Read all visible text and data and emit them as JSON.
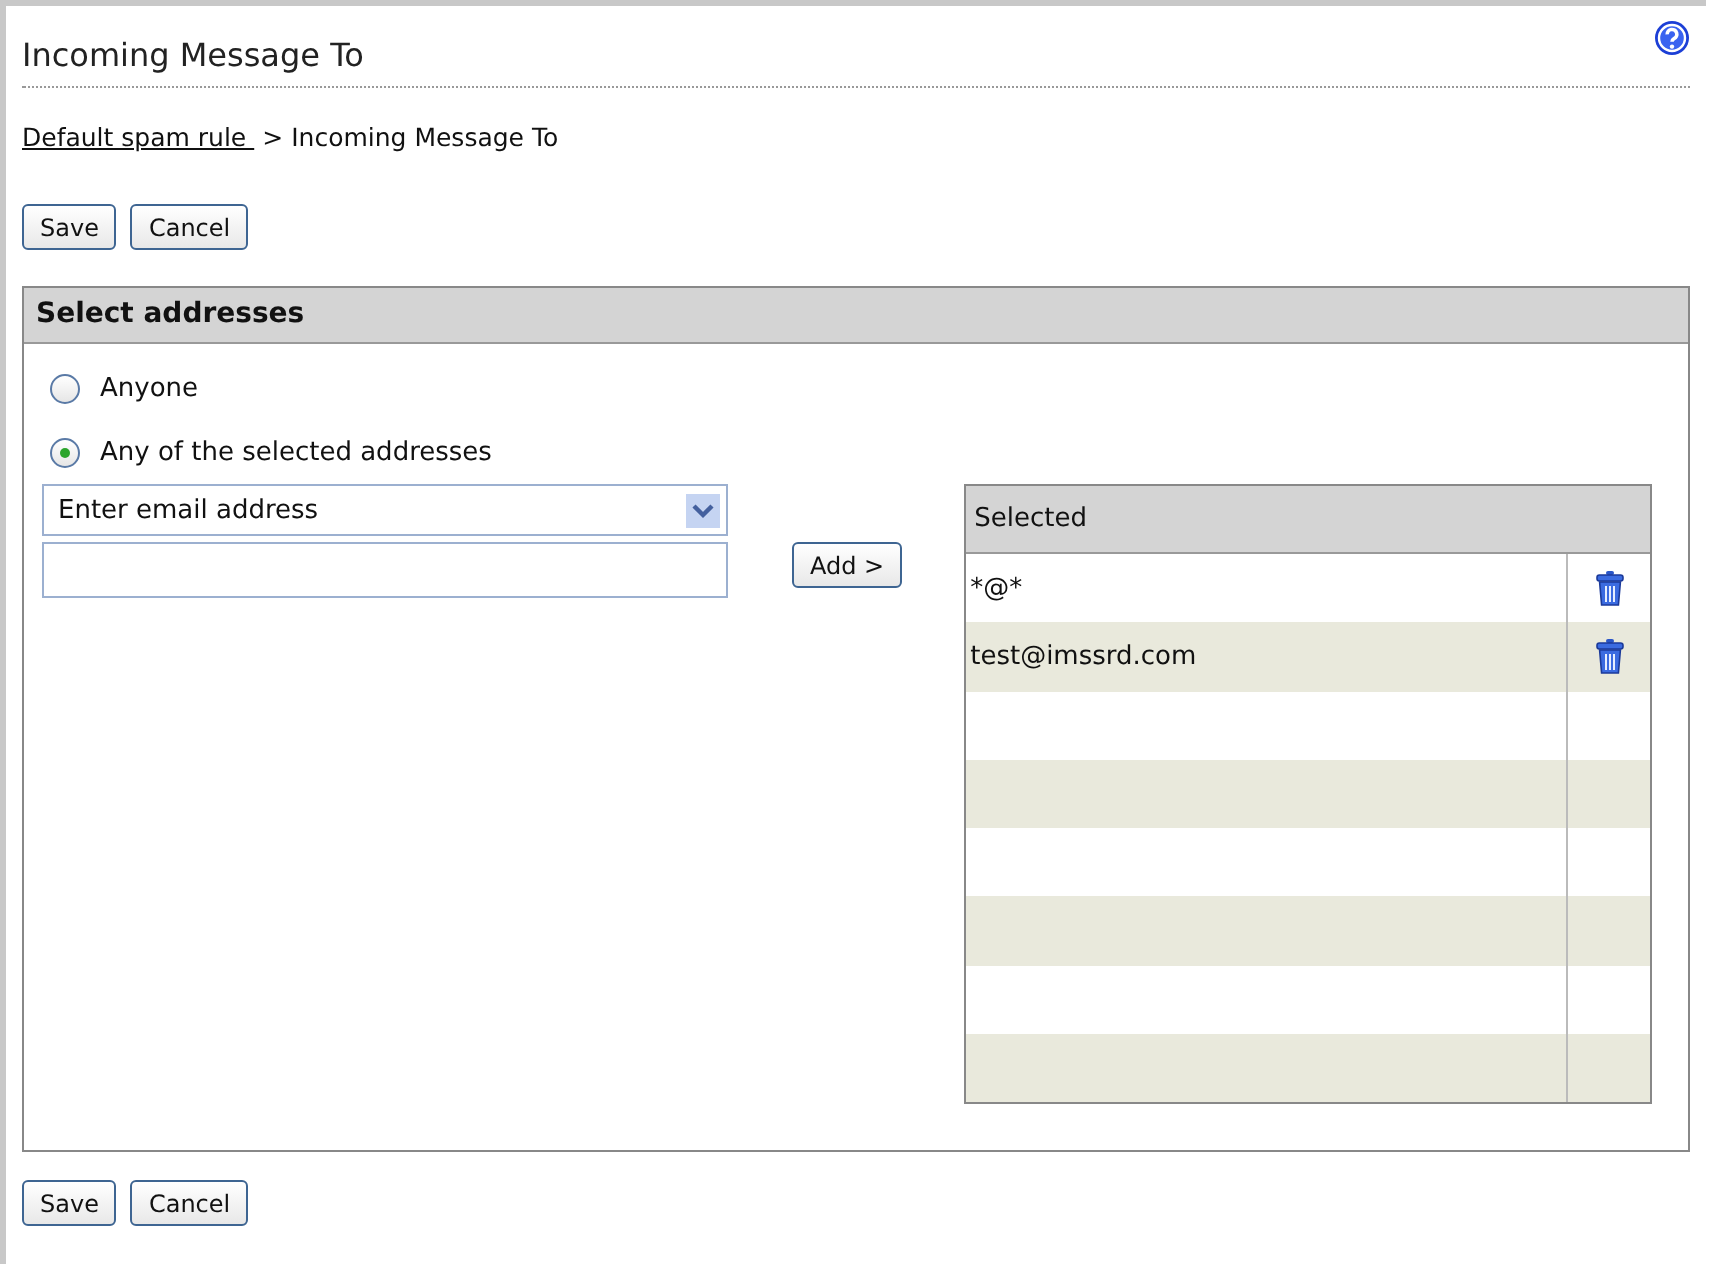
{
  "page": {
    "title": "Incoming Message To"
  },
  "breadcrumb": {
    "link": "Default spam rule ",
    "separator": ">",
    "current": "Incoming Message To"
  },
  "top_buttons": [
    "Save",
    "Cancel"
  ],
  "panel": {
    "title": "Select addresses",
    "options": [
      {
        "label": "Anyone",
        "selected": false
      },
      {
        "label": "Any of the selected addresses",
        "selected": true
      }
    ],
    "address_type": {
      "value": "Enter email address"
    },
    "add_button": "Add >",
    "selected_list": {
      "header": "Selected",
      "rows": [
        {
          "address": "*@*"
        },
        {
          "address": "test@imssrd.com"
        }
      ]
    }
  },
  "bottom_buttons": [
    "Save",
    "Cancel"
  ]
}
